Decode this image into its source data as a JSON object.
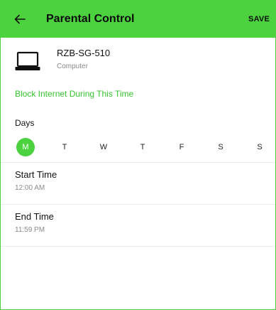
{
  "header": {
    "title": "Parental Control",
    "save_label": "SAVE",
    "back_icon": "arrow-left-icon",
    "bg_color": "#4cd23f"
  },
  "device": {
    "name": "RZB-SG-510",
    "type": "Computer",
    "icon": "laptop-icon"
  },
  "block_label": "Block Internet During This Time",
  "days": {
    "label": "Days",
    "items": [
      {
        "label": "M",
        "selected": true
      },
      {
        "label": "T",
        "selected": false
      },
      {
        "label": "W",
        "selected": false
      },
      {
        "label": "T",
        "selected": false
      },
      {
        "label": "F",
        "selected": false
      },
      {
        "label": "S",
        "selected": false
      },
      {
        "label": "S",
        "selected": false
      }
    ]
  },
  "start_time": {
    "label": "Start Time",
    "value": "12:00 AM"
  },
  "end_time": {
    "label": "End Time",
    "value": "11:59 PM"
  },
  "accent_color": "#36c22f"
}
